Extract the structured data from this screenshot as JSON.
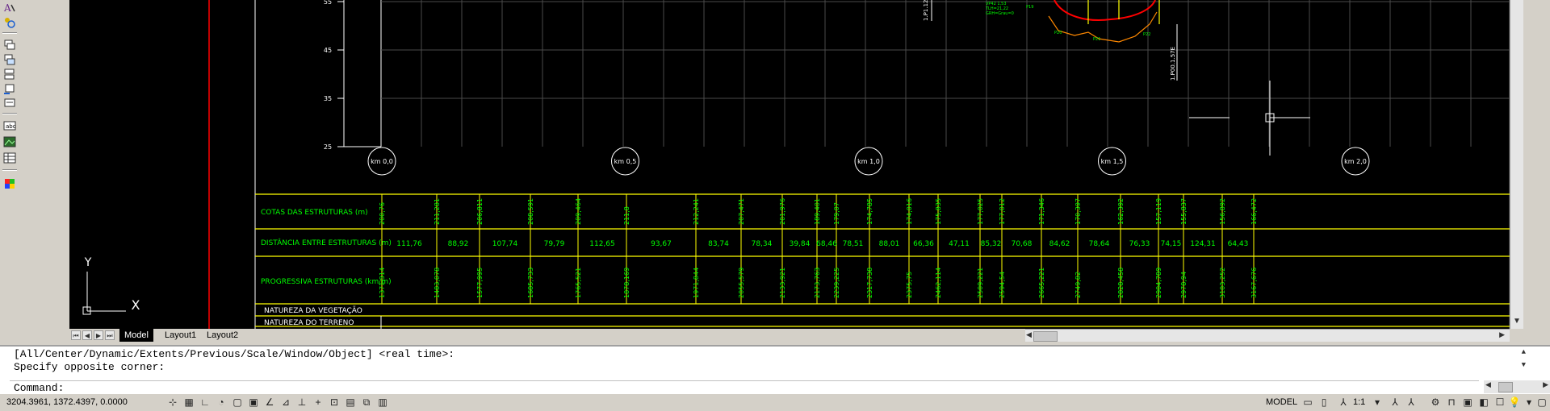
{
  "drawing": {
    "elevation_ticks": [
      "55",
      "45",
      "35",
      "25"
    ],
    "km_markers": [
      "km 0,0",
      "km 0,5",
      "km 1,0",
      "km 1,5",
      "km 2,0"
    ],
    "row_labels": {
      "cotas": "COTAS DAS ESTRUTURAS (m)",
      "distancia": "DISTÂNCIA ENTRE ESTRUTURAS (m)",
      "progressiva": "PROGRESSIVA ESTRUTURAS (km/m)",
      "vegetacao": "NATUREZA DA VEGETAÇÃO",
      "terreno": "NATUREZA DO TERRENO"
    },
    "cotas": [
      "200,76",
      "211,281",
      "206,811",
      "208,591",
      "209,464",
      "211,8",
      "212,241",
      "207,471",
      "201,976",
      "189,401",
      "179,07",
      "174,785",
      "174,016",
      "175,835",
      "177,025",
      "177,012",
      "171,346",
      "170,397",
      "162,392",
      "157,119",
      "155,837",
      "156,892",
      "166,472"
    ],
    "distancias": [
      "111,76",
      "88,92",
      "107,74",
      "79,79",
      "112,65",
      "93,67",
      "83,74",
      "78,34",
      "39,84",
      "68,46",
      "78,51",
      "88,01",
      "66,36",
      "47,11",
      "85,32",
      "70,68",
      "84,62",
      "78,64",
      "76,33",
      "74,15",
      "124,31",
      "64,43"
    ],
    "progressivas": [
      "1371,314",
      "1483,078",
      "1577,995",
      "1685,733",
      "1765,521",
      "1878,169",
      "1971,844",
      "2055,579",
      "2133,921",
      "2173,763",
      "2239,225",
      "2317,738",
      "2375,75",
      "2462,114",
      "2509,221",
      "2594,54",
      "2665,221",
      "2749,82",
      "2828,458",
      "2904,789",
      "2978,94",
      "3103,252",
      "3167,676"
    ],
    "structure_labels_vertical": [
      "1.P1.12",
      "1.P00.1.57E"
    ],
    "tiny_labels": [
      "P20",
      "P21",
      "P22",
      "P19"
    ],
    "ucs": {
      "y_label": "Y",
      "x_label": "X"
    }
  },
  "tabs": {
    "model": "Model",
    "layout1": "Layout1",
    "layout2": "Layout2"
  },
  "command": {
    "history_line1": "[All/Center/Dynamic/Extents/Previous/Scale/Window/Object] <real time>:",
    "history_line2": "Specify opposite corner:",
    "prompt": "Command:"
  },
  "status": {
    "coordinates": "3204.3961, 1372.4397, 0.0000",
    "model_label": "MODEL",
    "scale": "1:1"
  },
  "colors": {
    "grid": "#5a5a5a",
    "table_lines": "#ffff00",
    "table_text": "#00ff00",
    "red": "#ff0000",
    "white": "#ffffff"
  }
}
